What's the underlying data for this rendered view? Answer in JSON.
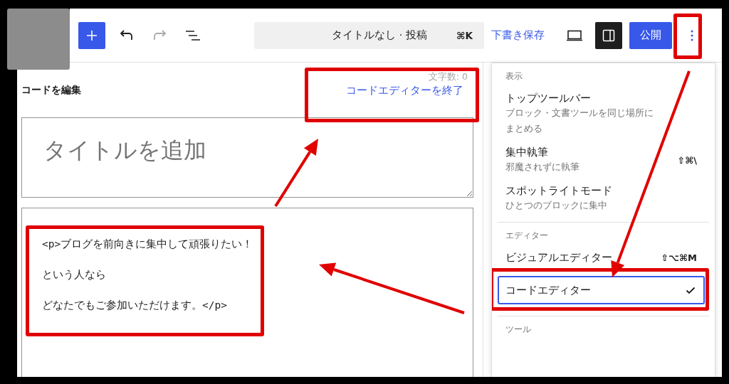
{
  "toolbar": {
    "document_title": "タイトルなし · 投稿",
    "shortcut": "⌘K",
    "save_draft": "下書き保存",
    "settings_pressed": true,
    "publish": "公開"
  },
  "code_editor": {
    "heading": "コードを編集",
    "word_count": "文字数: 0",
    "exit_link": "コードエディターを終了",
    "title_placeholder": "タイトルを追加",
    "content_lines": [
      "<p>ブログを前向きに集中して頑張りたい！",
      "という人なら",
      "どなたでもご参加いただけます。</p>"
    ]
  },
  "options_menu": {
    "open": true,
    "sections": [
      {
        "heading": "表示",
        "items": [
          {
            "label": "トップツールバー",
            "description": "ブロック・文書ツールを同じ場所にまとめる",
            "checked": false,
            "focused": false
          },
          {
            "label": "集中執筆",
            "description": "邪魔されずに執筆",
            "shortcut": "⇧⌘\\",
            "checked": false,
            "focused": false
          },
          {
            "label": "スポットライトモード",
            "description": "ひとつのブロックに集中",
            "checked": false,
            "focused": false
          }
        ]
      },
      {
        "heading": "エディター",
        "items": [
          {
            "label": "ビジュアルエディター",
            "shortcut": "⇧⌥⌘M",
            "checked": false,
            "focused": false
          },
          {
            "label": "コードエディター",
            "checked": true,
            "focused": true
          }
        ]
      },
      {
        "heading": "ツール"
      }
    ]
  }
}
